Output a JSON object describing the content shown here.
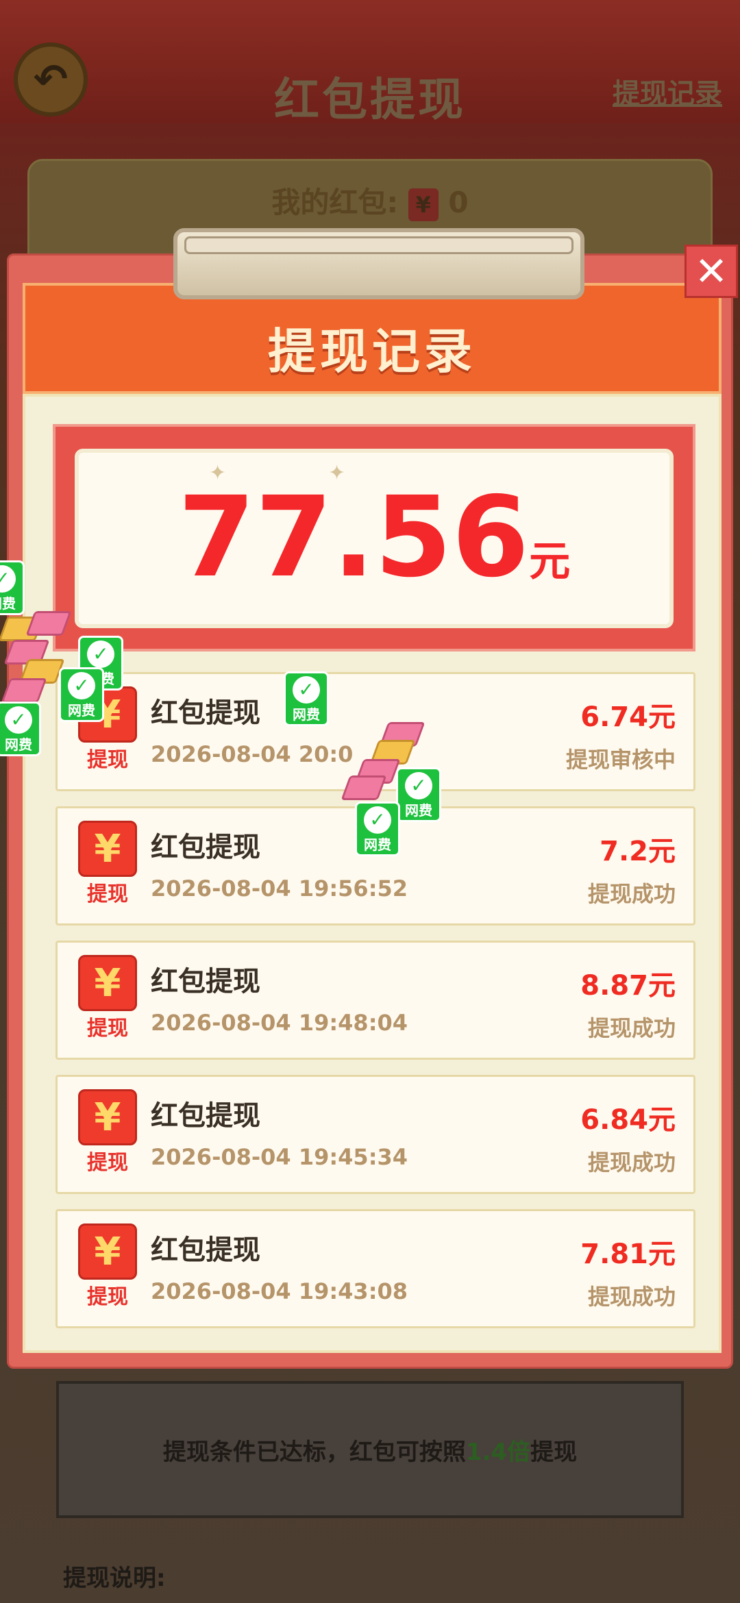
{
  "background": {
    "title": "红包提现",
    "record_link": "提现记录",
    "balance_label": "我的红包:",
    "balance_yen": "¥",
    "balance_value": "0",
    "condition_text": "提现条件已达标，红包可按照",
    "condition_multiplier": "1.4倍",
    "condition_suffix": "提现",
    "note_title": "提现说明:"
  },
  "modal": {
    "title": "提现记录",
    "close_label": "✕",
    "total_amount": "77.56",
    "total_unit": "元",
    "records": [
      {
        "icon_symbol": "¥",
        "icon_label": "提现",
        "title": "红包提现",
        "time": "2026-08-04 20:0",
        "amount": "6.74元",
        "status": "提现审核中"
      },
      {
        "icon_symbol": "¥",
        "icon_label": "提现",
        "title": "红包提现",
        "time": "2026-08-04 19:56:52",
        "amount": "7.2元",
        "status": "提现成功"
      },
      {
        "icon_symbol": "¥",
        "icon_label": "提现",
        "title": "红包提现",
        "time": "2026-08-04 19:48:04",
        "amount": "8.87元",
        "status": "提现成功"
      },
      {
        "icon_symbol": "¥",
        "icon_label": "提现",
        "title": "红包提现",
        "time": "2026-08-04 19:45:34",
        "amount": "6.84元",
        "status": "提现成功"
      },
      {
        "icon_symbol": "¥",
        "icon_label": "提现",
        "title": "红包提现",
        "time": "2026-08-04 19:43:08",
        "amount": "7.81元",
        "status": "提现成功"
      }
    ]
  },
  "confetti": {
    "wechat_label": "网费",
    "check_symbol": "✓"
  }
}
